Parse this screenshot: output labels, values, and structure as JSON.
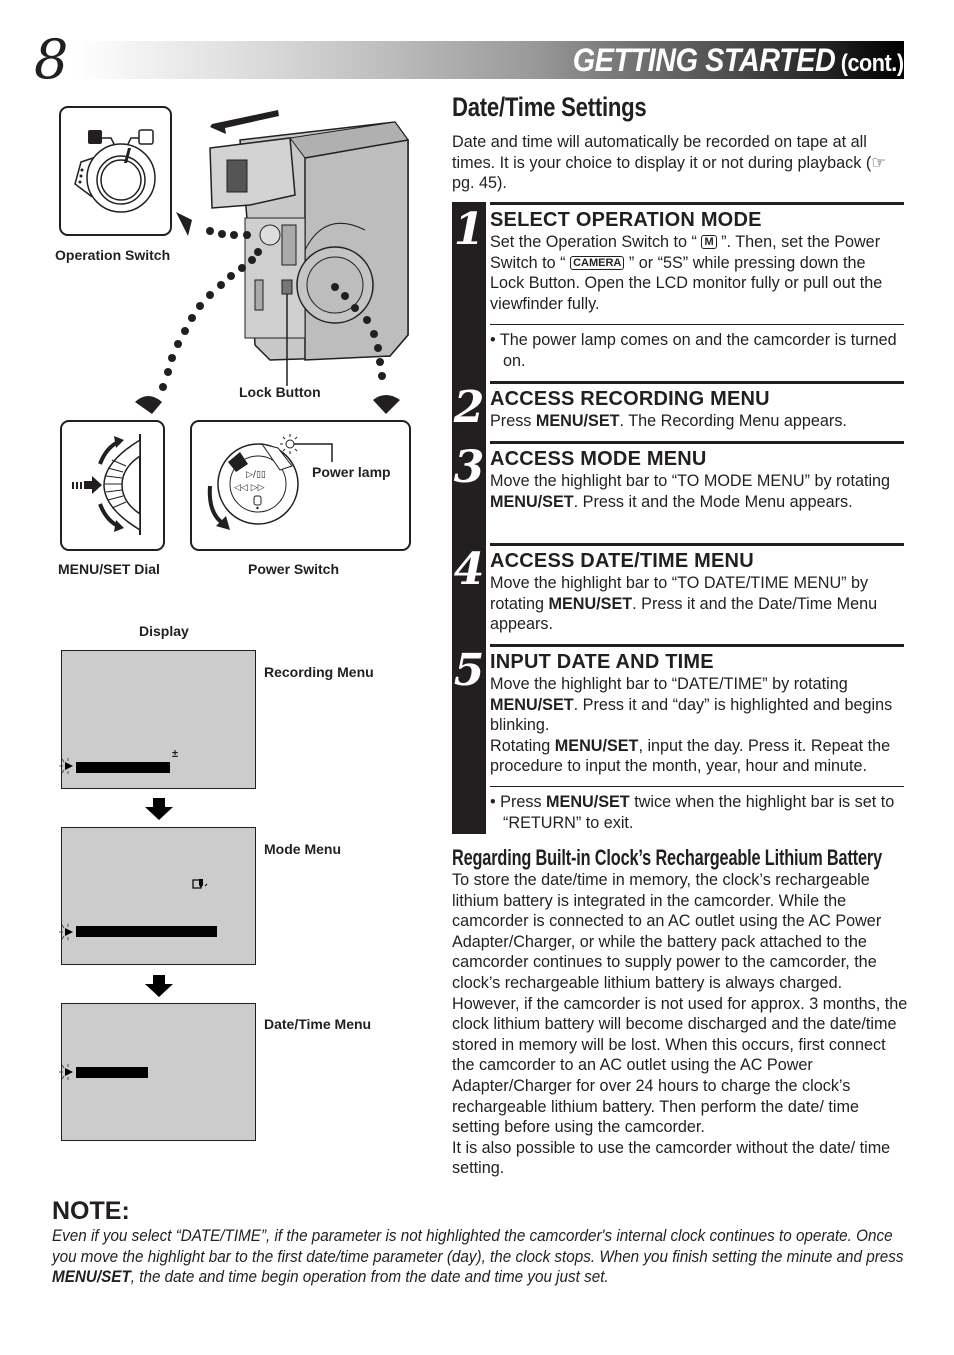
{
  "header": {
    "page_number": "8",
    "title": "GETTING STARTED",
    "title_suffix": "(cont.)"
  },
  "section": {
    "title": "Date/Time Settings",
    "intro": "Date and time will automatically be recorded on tape at all times. It is your choice to display it or not during playback (",
    "intro_ref_icon": "☞",
    "intro_ref": " pg. 45)."
  },
  "steps": [
    {
      "number": "1",
      "heading": "SELECT OPERATION MODE",
      "text_parts": {
        "a": "Set the Operation Switch to “ ",
        "badge_m": "M",
        "b": " ”. Then, set the Power Switch to “ ",
        "badge_camera": "CAMERA",
        "c": " ” or “5S” while pressing down the Lock Button. Open the LCD monitor fully or pull out the viewfinder fully."
      },
      "bullet": "• The power lamp comes on and the camcorder is turned on."
    },
    {
      "number": "2",
      "heading": "ACCESS RECORDING MENU",
      "text_parts": {
        "a": "Press ",
        "bold1": "MENU/SET",
        "b": ". The Recording Menu appears."
      }
    },
    {
      "number": "3",
      "heading": "ACCESS MODE MENU",
      "text_parts": {
        "a": "Move the highlight bar to “TO MODE MENU” by rotating ",
        "bold1": "MENU/SET",
        "b": ". Press it and the Mode Menu appears."
      }
    },
    {
      "number": "4",
      "heading": "ACCESS DATE/TIME MENU",
      "text_parts": {
        "a": "Move the highlight bar to “TO DATE/TIME MENU” by rotating ",
        "bold1": "MENU/SET",
        "b": ". Press it and the Date/Time Menu appears."
      }
    },
    {
      "number": "5",
      "heading": "INPUT DATE AND TIME",
      "text_parts": {
        "a": "Move the highlight bar to “DATE/TIME” by rotating ",
        "bold1": "MENU/SET",
        "b": ". Press it and “day” is highlighted and begins blinking.",
        "c": "Rotating ",
        "bold2": "MENU/SET",
        "d": ", input the day. Press it. Repeat the procedure to input the month, year, hour and minute."
      },
      "bullet_parts": {
        "a": "• Press ",
        "bold1": "MENU/SET",
        "b": " twice when the highlight bar is set to “RETURN” to exit."
      }
    }
  ],
  "battery": {
    "title": "Regarding Built-in Clock’s Rechargeable Lithium Battery",
    "text1": "To store the date/time in memory, the clock’s rechargeable lithium battery is integrated in the camcorder. While the camcorder is connected to an AC outlet using the AC Power Adapter/Charger, or while the battery pack attached to the camcorder continues to supply power to the camcorder, the clock’s rechargeable lithium battery is always charged. However, if the camcorder is not used for approx. 3 months, the clock lithium battery will become discharged and the date/time stored in memory will be lost. When this occurs, first connect the camcorder to an AC outlet using the AC Power Adapter/Charger for over 24 hours to charge the clock’s rechargeable lithium battery. Then perform the date/ time setting before using the camcorder.",
    "text2": "It is also possible to use the camcorder without the date/ time setting."
  },
  "note": {
    "title": "NOTE:",
    "a": "Even if you select “DATE/TIME”, if the parameter is not highlighted the camcorder's internal clock continues to operate. Once you move the highlight bar to the first date/time parameter (day), the clock stops. When you finish setting the minute and press ",
    "bold1": "MENU/SET",
    "b": ", the date and time begin operation from the date and time you just set."
  },
  "illustrations": {
    "operation_switch_label": "Operation Switch",
    "lock_button_label": "Lock Button",
    "menu_set_dial_label": "MENU/SET Dial",
    "power_switch_label": "Power Switch",
    "power_lamp_label": "Power lamp",
    "display_label": "Display",
    "screens": [
      {
        "label": "Recording Menu",
        "indicator": "±"
      },
      {
        "label": "Mode Menu",
        "indicator": ""
      },
      {
        "label": "Date/Time Menu",
        "indicator": ""
      }
    ]
  }
}
